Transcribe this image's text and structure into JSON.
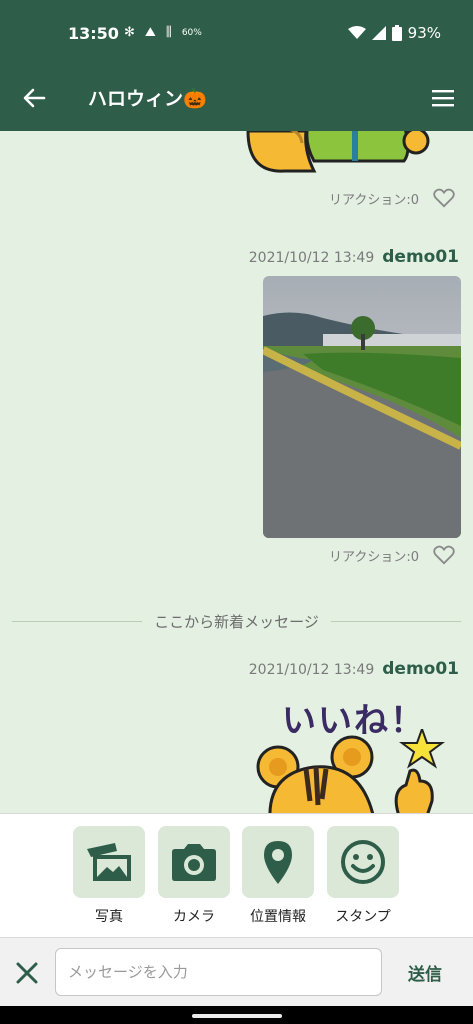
{
  "status_bar": {
    "time": "13:50",
    "notif_text": "60%",
    "battery": "93%"
  },
  "app_bar": {
    "title": "ハロウィン🎃"
  },
  "messages": [
    {
      "reaction_label": "リアクション:0"
    },
    {
      "timestamp": "2021/10/12 13:49",
      "user": "demo01",
      "reaction_label": "リアクション:0"
    },
    {
      "timestamp": "2021/10/12 13:49",
      "user": "demo01",
      "sticker_text": "いいね！"
    }
  ],
  "divider_text": "ここから新着メッセージ",
  "attachments": [
    {
      "label": "写真",
      "icon": "photo-icon"
    },
    {
      "label": "カメラ",
      "icon": "camera-icon"
    },
    {
      "label": "位置情報",
      "icon": "location-pin-icon"
    },
    {
      "label": "スタンプ",
      "icon": "smiley-icon"
    }
  ],
  "input": {
    "placeholder": "メッセージを入力",
    "send_label": "送信"
  },
  "colors": {
    "primary": "#2e5e49",
    "chat_bg": "#e3f0e2",
    "tile_bg": "#dbe8d8"
  }
}
